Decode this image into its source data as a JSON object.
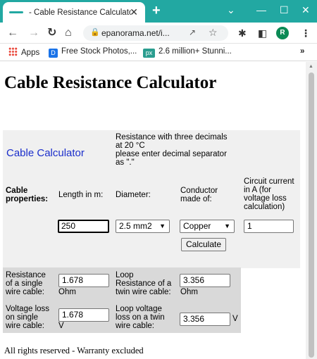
{
  "browser": {
    "tab_title": "- Cable Resistance Calculator",
    "tab_close": "✕",
    "new_tab": "+",
    "url": "epanorama.net/i...",
    "profile_initial": "R",
    "bookmarks": [
      {
        "label": "Apps",
        "icon": "apps-grid-icon"
      },
      {
        "label": "Free Stock Photos,...",
        "icon": "d-favicon"
      },
      {
        "label": "2.6 million+ Stunni...",
        "icon": "px-favicon"
      }
    ],
    "bookmarks_more": "»",
    "px_badge": "px",
    "d_badge": "D"
  },
  "page": {
    "title": "Cable Resistance Calculator",
    "calculator_heading": "Cable Calculator",
    "intro_lines": [
      "Resistance with three decimals",
      "at 20 °C",
      "please enter decimal separator",
      "as \".\""
    ],
    "row_label_lines": [
      "Cable",
      "properties:"
    ],
    "headers": {
      "length": "Length in m:",
      "diameter": "Diameter:",
      "conductor_lines": [
        "Conductor",
        "made of:"
      ],
      "current_lines": [
        "Circuit current",
        "in A (for",
        "voltage loss",
        "calculation)"
      ]
    },
    "inputs": {
      "length_value": "250",
      "diameter_selected": "2.5 mm2",
      "conductor_selected": "Copper",
      "current_value": "1"
    },
    "calculate_label": "Calculate",
    "results": {
      "single_label_lines": [
        "Resistance",
        "of a single",
        "wire cable:"
      ],
      "single_value": "1.678",
      "single_unit": "Ohm",
      "loop_label_lines": [
        "Loop",
        "Resistance of a",
        "twin wire cable:"
      ],
      "loop_value": "3.356",
      "loop_unit": "Ohm",
      "vloss_label_lines": [
        "Voltage loss",
        "on single",
        "wire cable:"
      ],
      "vloss_value": "1.678",
      "vloss_unit": "V",
      "loop_vloss_label_lines": [
        "Loop voltage",
        "loss on a twin",
        "wire cable:"
      ],
      "loop_vloss_value": "3.356",
      "loop_vloss_unit": "V"
    },
    "footer": "All rights reserved - Warranty excluded"
  }
}
